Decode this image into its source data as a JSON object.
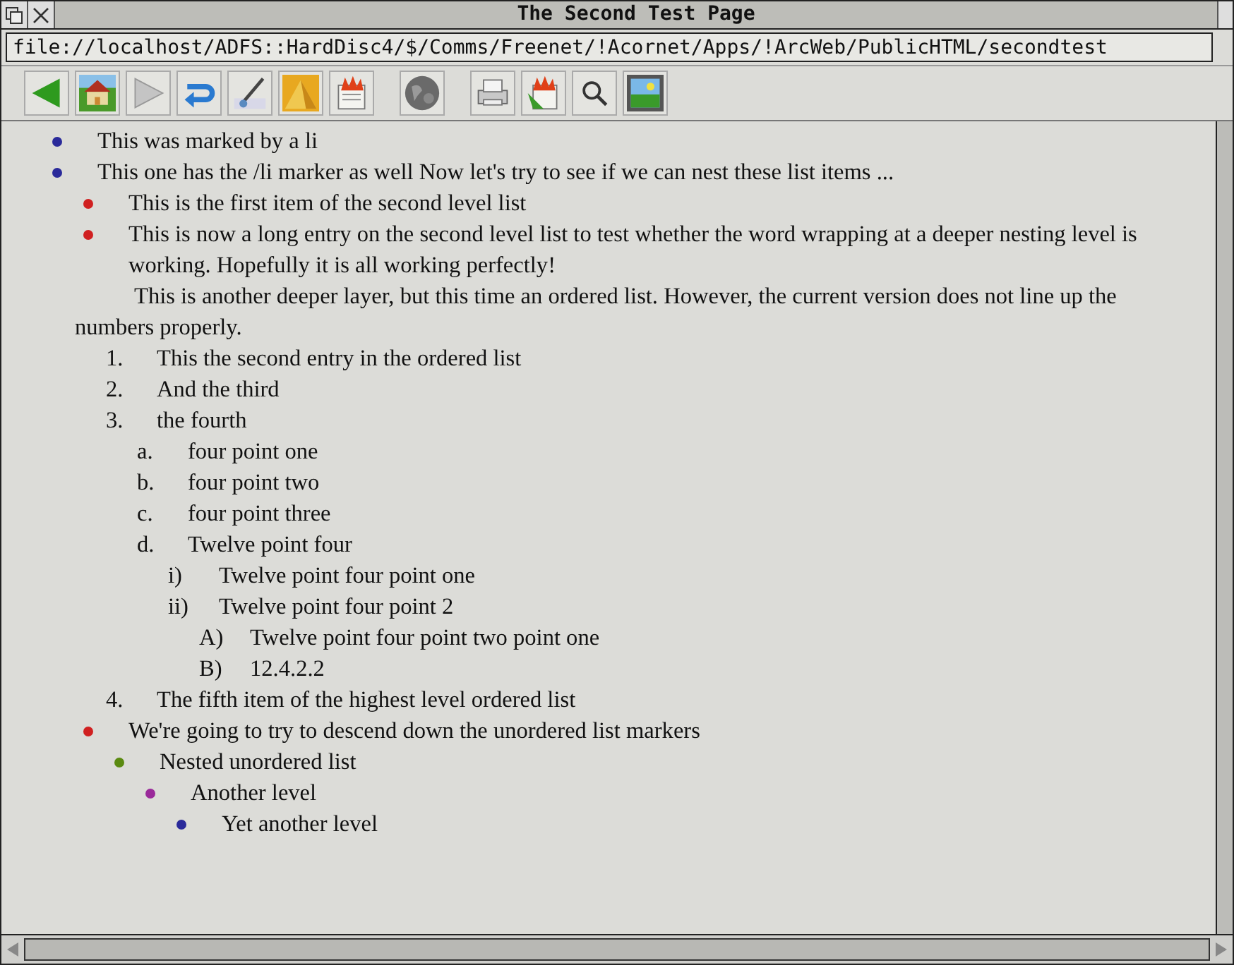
{
  "window": {
    "title": "The Second Test Page"
  },
  "url_bar": {
    "value": "file://localhost/ADFS::HardDisc4/$/Comms/Freenet/!Acornet/Apps/!ArcWeb/PublicHTML/secondtest"
  },
  "toolbar": {
    "buttons": [
      {
        "kind": "back"
      },
      {
        "kind": "home"
      },
      {
        "kind": "forward"
      },
      {
        "kind": "reload"
      },
      {
        "kind": "brush"
      },
      {
        "kind": "pyramid"
      },
      {
        "kind": "fire-page"
      },
      {
        "kind": "globe"
      },
      {
        "kind": "printer"
      },
      {
        "kind": "fire-arrow"
      },
      {
        "kind": "search"
      },
      {
        "kind": "picture"
      }
    ]
  },
  "content": [
    {
      "kind": "bullet",
      "color": "#2a2a9a",
      "text": "This was marked by a li"
    },
    {
      "kind": "bullet",
      "color": "#2a2a9a",
      "text": "This one has the /li marker as well Now let's try to see if we can nest these list items ...",
      "children": [
        {
          "kind": "bullet",
          "color": "#d02020",
          "text": "This is the first item of the second level list"
        },
        {
          "kind": "bullet",
          "color": "#d02020",
          "text": "This is now a long entry on the second level list to test whether the word wrapping at a deeper nesting level is working. Hopefully it is all working perfectly!",
          "children": [
            {
              "kind": "paragraph",
              "text": "This is another deeper layer, but this time an ordered list. However, the current version does not line up the numbers properly."
            },
            {
              "kind": "numbered",
              "marker": "1.",
              "text": "This the second entry in the ordered list"
            },
            {
              "kind": "numbered",
              "marker": "2.",
              "text": "And the third"
            },
            {
              "kind": "numbered",
              "marker": "3.",
              "text": "the fourth",
              "children": [
                {
                  "kind": "numbered",
                  "marker": "a.",
                  "text": "four point one"
                },
                {
                  "kind": "numbered",
                  "marker": "b.",
                  "text": "four point two"
                },
                {
                  "kind": "numbered",
                  "marker": "c.",
                  "text": "four point three"
                },
                {
                  "kind": "numbered",
                  "marker": "d.",
                  "text": "Twelve point four",
                  "children": [
                    {
                      "kind": "numbered",
                      "marker": "i)",
                      "text": "Twelve point four point one"
                    },
                    {
                      "kind": "numbered",
                      "marker": "ii)",
                      "text": "Twelve point four point 2",
                      "children": [
                        {
                          "kind": "numbered",
                          "marker": "A)",
                          "text": "Twelve point four point two point one"
                        },
                        {
                          "kind": "numbered",
                          "marker": "B)",
                          "text": "12.4.2.2"
                        }
                      ]
                    }
                  ]
                }
              ]
            },
            {
              "kind": "numbered",
              "marker": "4.",
              "text": "The fifth item of the highest level ordered list"
            }
          ]
        },
        {
          "kind": "bullet",
          "color": "#d02020",
          "text": "We're going to try to descend down the unordered list markers",
          "children": [
            {
              "kind": "bullet",
              "color": "#5a8a10",
              "text": "Nested unordered list",
              "children": [
                {
                  "kind": "bullet",
                  "color": "#9a2a9a",
                  "text": "Another level",
                  "children": [
                    {
                      "kind": "bullet",
                      "color": "#2a2a9a",
                      "text": "Yet another level"
                    }
                  ]
                }
              ]
            }
          ]
        }
      ]
    }
  ]
}
